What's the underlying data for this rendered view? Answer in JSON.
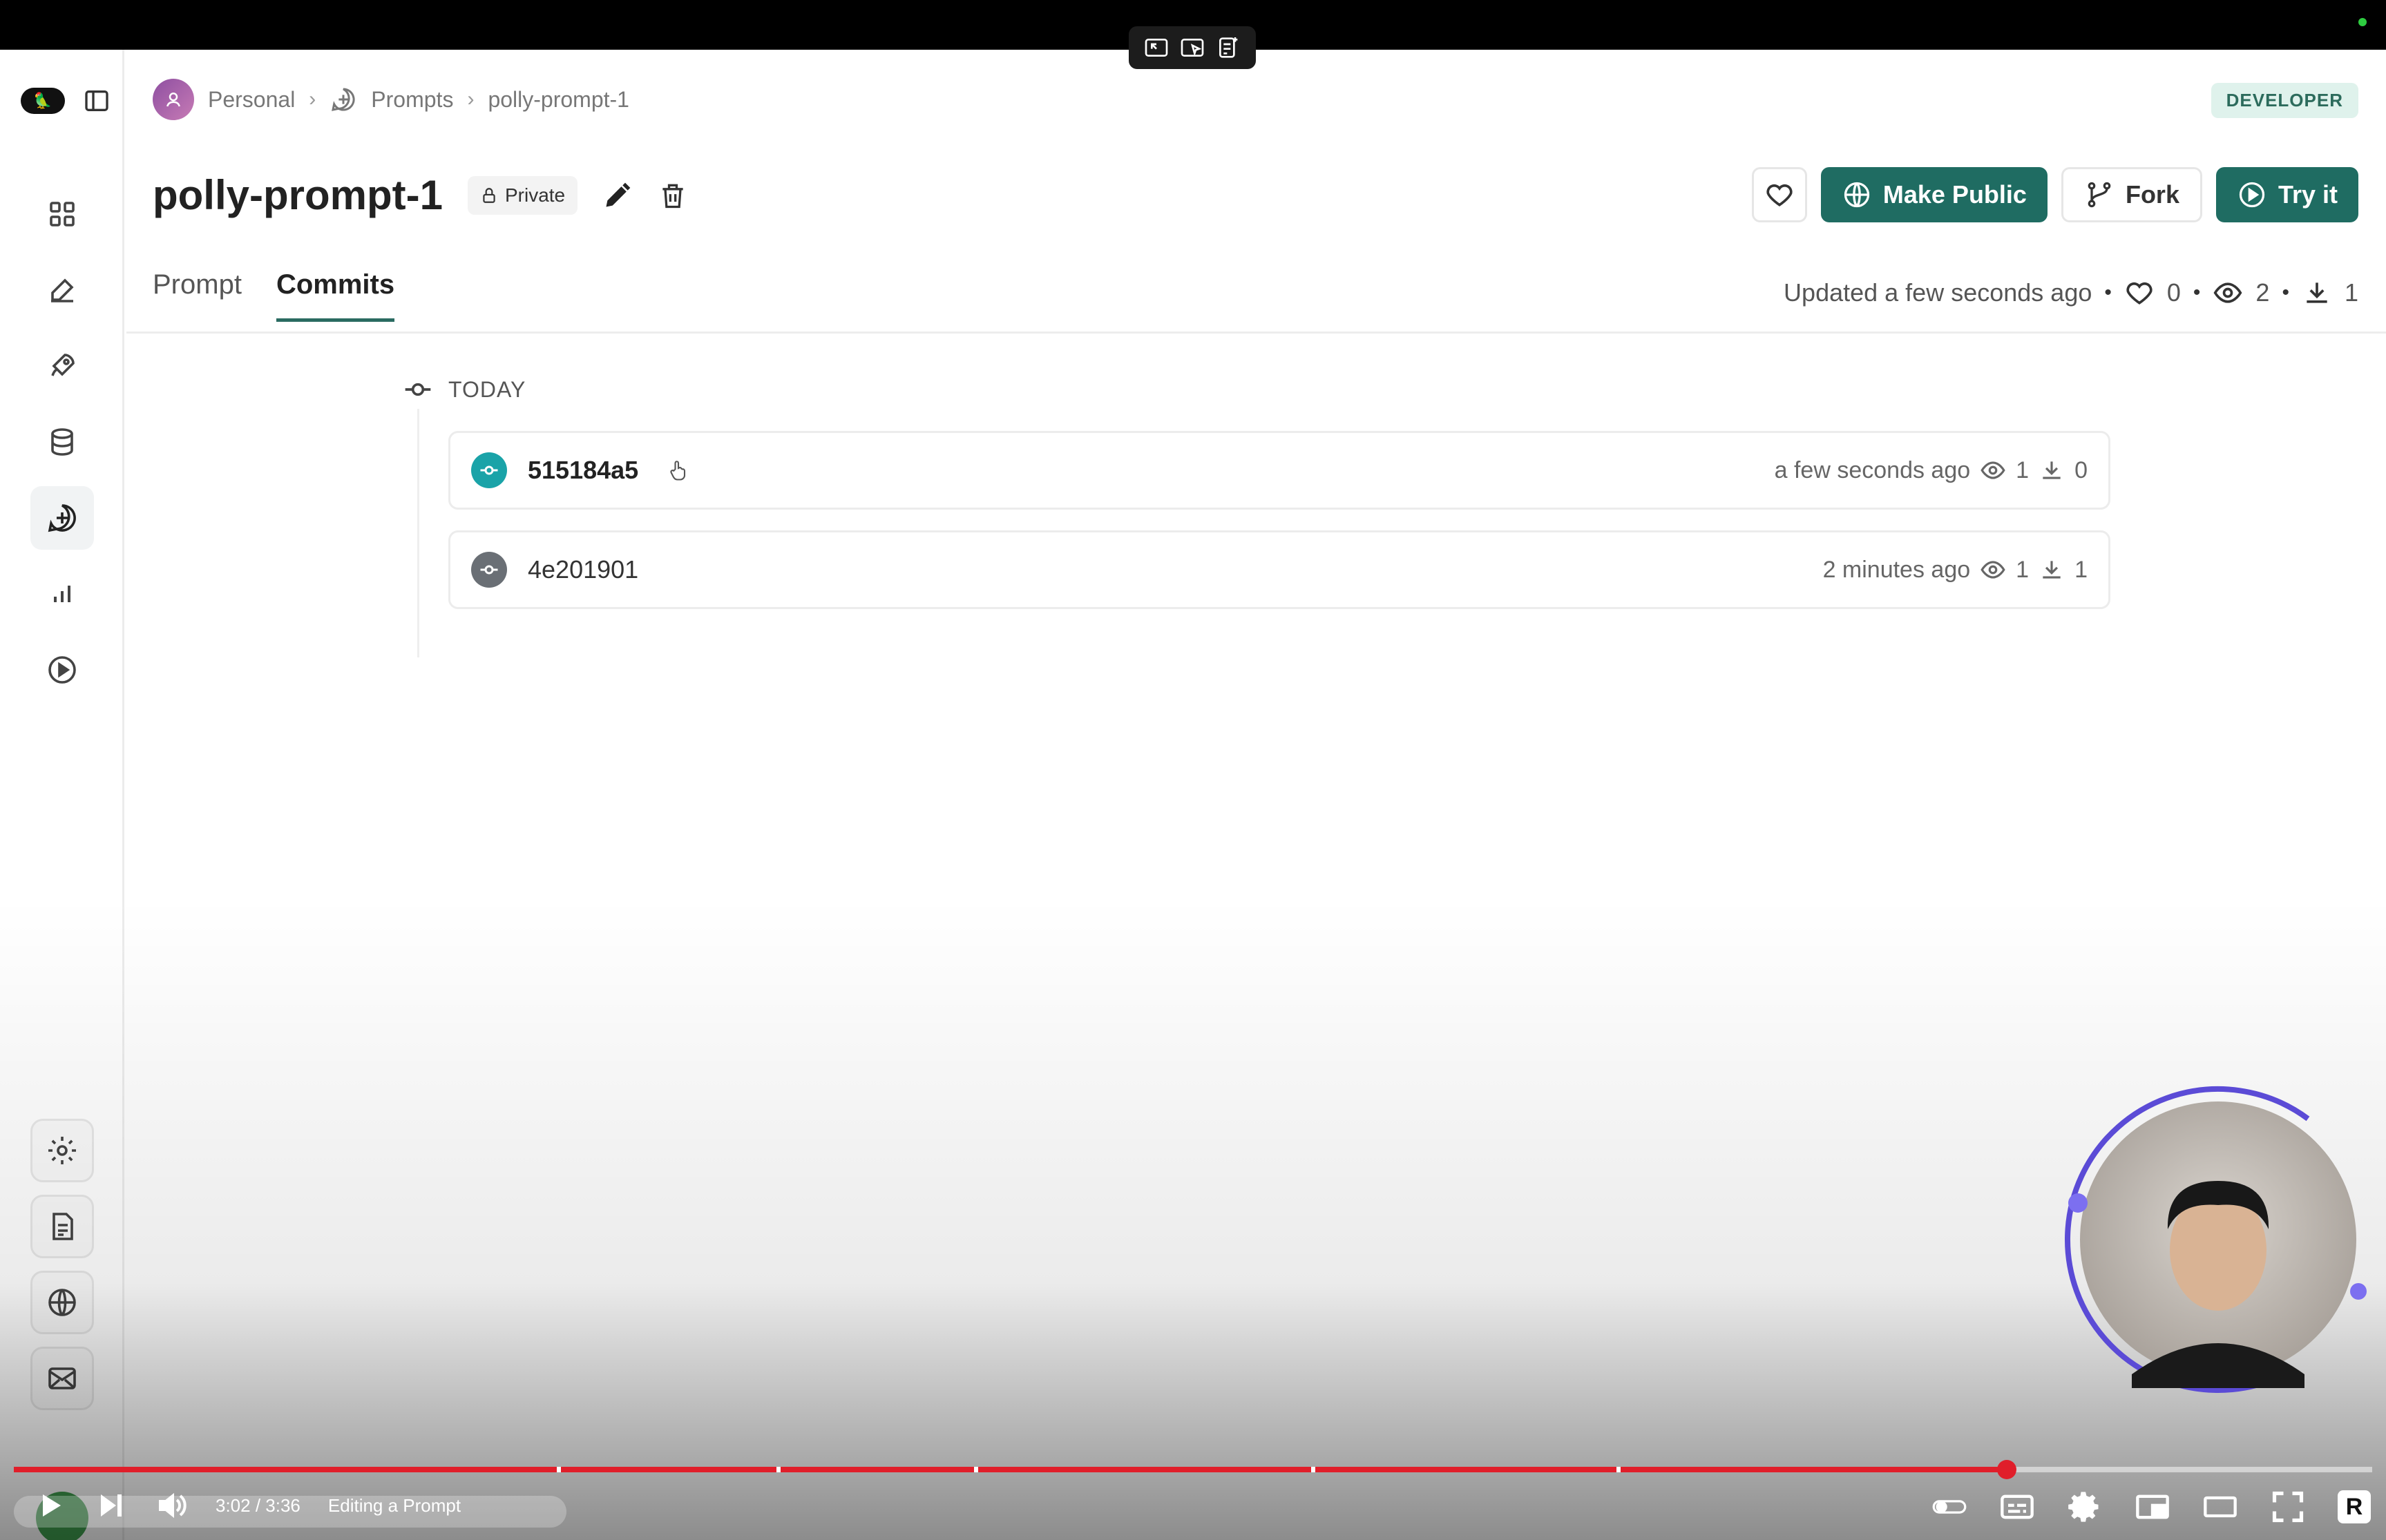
{
  "breadcrumb": {
    "workspace": "Personal",
    "section": "Prompts",
    "current": "polly-prompt-1"
  },
  "role_badge": "DEVELOPER",
  "prompt": {
    "title": "polly-prompt-1",
    "visibility": "Private"
  },
  "actions": {
    "make_public": "Make Public",
    "fork": "Fork",
    "try_it": "Try it"
  },
  "tabs": [
    {
      "label": "Prompt",
      "active": false
    },
    {
      "label": "Commits",
      "active": true
    }
  ],
  "meta": {
    "updated": "Updated a few seconds ago",
    "likes": "0",
    "views": "2",
    "downloads": "1"
  },
  "timeline": {
    "group_label": "TODAY",
    "commits": [
      {
        "hash": "515184a5",
        "time": "a few seconds ago",
        "views": "1",
        "downloads": "0",
        "icon_color": "#1aa3a8"
      },
      {
        "hash": "4e201901",
        "time": "2 minutes ago",
        "views": "1",
        "downloads": "1",
        "icon_color": "#6a6f75"
      }
    ]
  },
  "video": {
    "time": "3:02 / 3:36",
    "chapter": "Editing a Prompt",
    "progress": 0.845
  },
  "colors": {
    "accent": "#1f6c62",
    "progress": "#e01e2a"
  }
}
